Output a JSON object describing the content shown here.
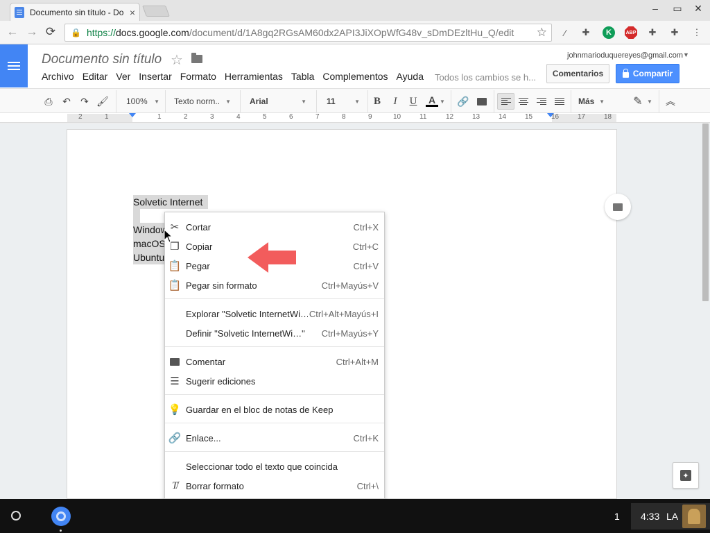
{
  "browser": {
    "tab_title": "Documento sin título - Do",
    "tab_close": "×",
    "window_controls": [
      "–",
      "▭",
      "✕"
    ],
    "nav": {
      "back": "←",
      "forward": "→",
      "reload": "⟳"
    },
    "url": {
      "scheme": "https://",
      "host": "docs.google.com",
      "path": "/document/d/1A8gq2RGsAM60dx2API3JiXOpWfG48v_sDmDEzltHu_Q/edit"
    },
    "extensions": [
      "wand-icon",
      "puzzle-icon",
      "k-icon",
      "abp-icon",
      "puzzle-icon",
      "puzzle-icon"
    ],
    "ext_k_label": "K",
    "ext_abp_label": "ABP"
  },
  "docs": {
    "title": "Documento sin título",
    "menu": [
      "Archivo",
      "Editar",
      "Ver",
      "Insertar",
      "Formato",
      "Herramientas",
      "Tabla",
      "Complementos",
      "Ayuda"
    ],
    "save_status": "Todos los cambios se h...",
    "user_email": "johnmarioduquereyes@gmail.com",
    "comments_button": "Comentarios",
    "share_button": "Compartir",
    "accent_color": "#4285f4"
  },
  "toolbar": {
    "zoom": "100%",
    "style": "Texto norm..",
    "font": "Arial",
    "size": "11",
    "bold": "B",
    "italic": "I",
    "underline": "U",
    "text_color": "A",
    "more": "Más"
  },
  "ruler": {
    "labels": [
      "2",
      "1",
      "1",
      "2",
      "3",
      "4",
      "5",
      "6",
      "7",
      "8",
      "9",
      "10",
      "11",
      "12",
      "13",
      "14",
      "15",
      "16",
      "17",
      "18"
    ]
  },
  "document": {
    "lines": [
      "Solvetic Internet",
      "Windows",
      "macOS",
      "Ubuntu"
    ]
  },
  "context_menu": {
    "items": [
      {
        "label": "Cortar",
        "shortcut": "Ctrl+X",
        "icon": "scissors-icon"
      },
      {
        "label": "Copiar",
        "shortcut": "Ctrl+C",
        "icon": "copy-icon"
      },
      {
        "label": "Pegar",
        "shortcut": "Ctrl+V",
        "icon": "paste-icon"
      },
      {
        "label": "Pegar sin formato",
        "shortcut": "Ctrl+Mayús+V",
        "icon": "paste-plain-icon"
      },
      {
        "label": "Explorar \"Solvetic InternetWi…\"",
        "shortcut": "Ctrl+Alt+Mayús+I",
        "icon": ""
      },
      {
        "label": "Definir \"Solvetic InternetWi…\"",
        "shortcut": "Ctrl+Mayús+Y",
        "icon": ""
      },
      {
        "label": "Comentar",
        "shortcut": "Ctrl+Alt+M",
        "icon": "comment-icon"
      },
      {
        "label": "Sugerir ediciones",
        "shortcut": "",
        "icon": "suggest-icon"
      },
      {
        "label": "Guardar en el bloc de notas de Keep",
        "shortcut": "",
        "icon": "bulb-icon"
      },
      {
        "label": "Enlace...",
        "shortcut": "Ctrl+K",
        "icon": "link-icon"
      },
      {
        "label": "Seleccionar todo el texto que coincida",
        "shortcut": "",
        "icon": ""
      },
      {
        "label": "Borrar formato",
        "shortcut": "Ctrl+\\",
        "icon": "clear-format-icon"
      }
    ]
  },
  "shelf": {
    "notification_count": "1",
    "time": "4:33",
    "input_method": "LA"
  }
}
